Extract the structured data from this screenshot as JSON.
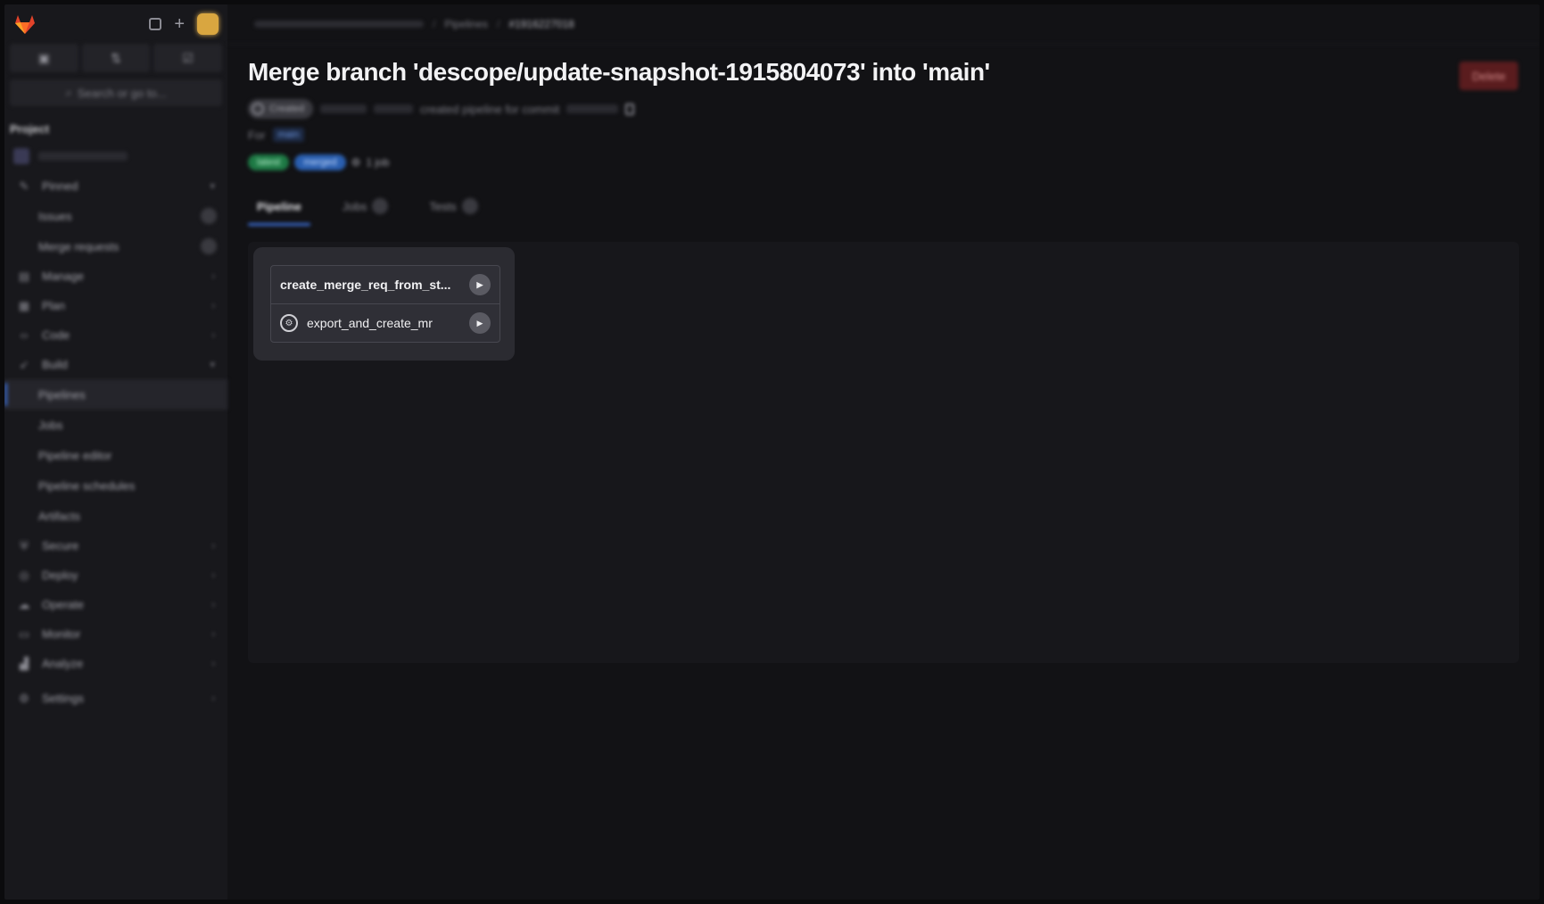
{
  "sidebar": {
    "search_label": "Search or go to...",
    "section_label": "Project",
    "pinned": {
      "label": "Pinned",
      "items": [
        {
          "label": "Issues"
        },
        {
          "label": "Merge requests"
        }
      ]
    },
    "groups": [
      {
        "label": "Manage",
        "icon": "manage-icon"
      },
      {
        "label": "Plan",
        "icon": "plan-icon"
      },
      {
        "label": "Code",
        "icon": "code-icon"
      },
      {
        "label": "Build",
        "icon": "rocket-icon"
      }
    ],
    "build_items": [
      {
        "label": "Pipelines"
      },
      {
        "label": "Jobs"
      },
      {
        "label": "Pipeline editor"
      },
      {
        "label": "Pipeline schedules"
      },
      {
        "label": "Artifacts"
      }
    ],
    "groups_after": [
      {
        "label": "Secure",
        "icon": "shield-icon"
      },
      {
        "label": "Deploy",
        "icon": "deploy-icon"
      },
      {
        "label": "Operate",
        "icon": "operate-icon"
      },
      {
        "label": "Monitor",
        "icon": "monitor-icon"
      },
      {
        "label": "Analyze",
        "icon": "analyze-icon"
      },
      {
        "label": "Settings",
        "icon": "gear-icon"
      }
    ]
  },
  "breadcrumb": {
    "pipelines": "Pipelines",
    "current": "#1916227018"
  },
  "page": {
    "title": "Merge branch 'descope/update-snapshot-1915804073' into 'main'",
    "delete_label": "Delete",
    "status_label": "Created",
    "meta_text": "created pipeline for commit",
    "for_label": "For",
    "branch": "main",
    "badge_green": "latest",
    "badge_blue": "merged",
    "job_count": "1 job"
  },
  "tabs": [
    {
      "label": "Pipeline"
    },
    {
      "label": "Jobs"
    },
    {
      "label": "Tests"
    }
  ],
  "pipeline": {
    "jobs": [
      {
        "name": "create_merge_req_from_st..."
      },
      {
        "name": "export_and_create_mr"
      }
    ]
  }
}
